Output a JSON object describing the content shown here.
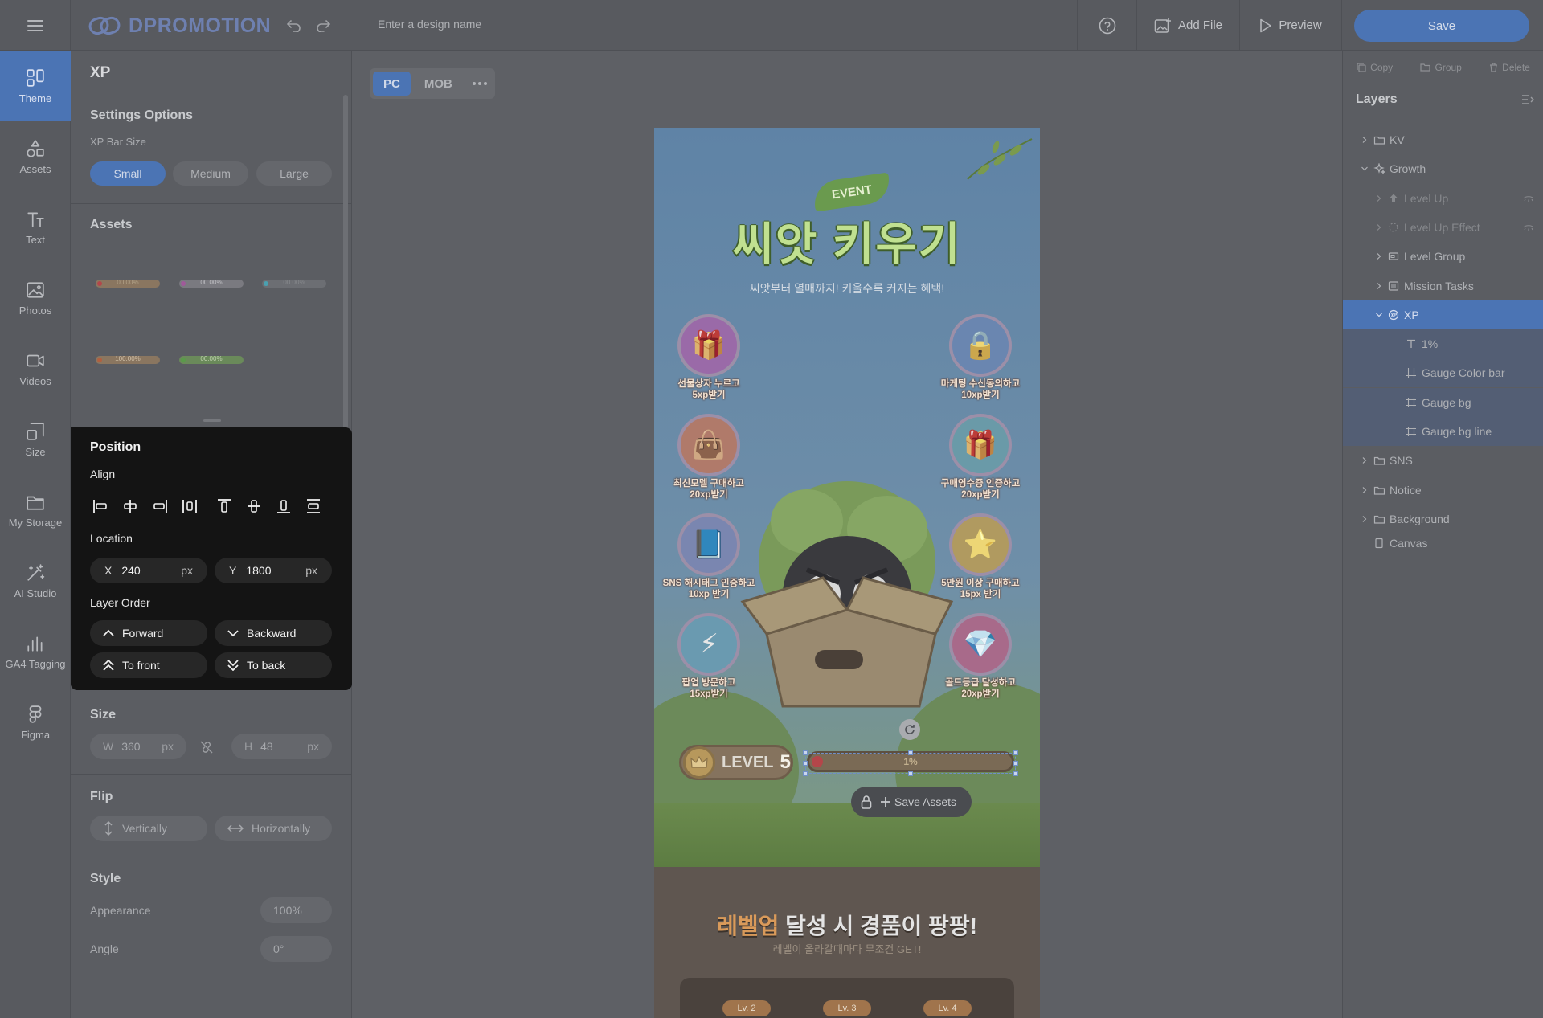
{
  "topbar": {
    "logo_text": "DPROMOTION",
    "design_name_placeholder": "Enter a design name",
    "add_file_label": "Add File",
    "preview_label": "Preview",
    "save_label": "Save"
  },
  "rail": [
    {
      "label": "Theme",
      "icon": "theme-icon",
      "active": true
    },
    {
      "label": "Assets",
      "icon": "shapes-icon"
    },
    {
      "label": "Text",
      "icon": "text-icon"
    },
    {
      "label": "Photos",
      "icon": "photo-icon"
    },
    {
      "label": "Videos",
      "icon": "video-icon"
    },
    {
      "label": "Size",
      "icon": "resize-icon"
    },
    {
      "label": "My Storage",
      "icon": "folder-icon"
    },
    {
      "label": "AI Studio",
      "icon": "magic-wand-icon"
    },
    {
      "label": "GA4 Tagging",
      "icon": "bar-chart-icon"
    },
    {
      "label": "Figma",
      "icon": "figma-icon"
    }
  ],
  "panel": {
    "title": "XP",
    "settings_title": "Settings Options",
    "xp_bar_size_label": "XP Bar Size",
    "sizes": [
      "Small",
      "Medium",
      "Large"
    ],
    "selected_size": "Small",
    "assets_title": "Assets",
    "asset_thumbs": [
      "00.00%",
      "00.00%",
      "00.00%",
      "100.00%",
      "00.00%"
    ],
    "size_title": "Size",
    "width_label": "W",
    "width_value": "360",
    "height_label": "H",
    "height_value": "48",
    "unit": "px",
    "flip_title": "Flip",
    "flip_vertical": "Vertically",
    "flip_horizontal": "Horizontally",
    "style_title": "Style",
    "appearance_label": "Appearance",
    "appearance_value": "100%",
    "angle_label": "Angle",
    "angle_value": "0°"
  },
  "position_popup": {
    "title": "Position",
    "align_label": "Align",
    "location_label": "Location",
    "x_label": "X",
    "x_value": "240",
    "y_label": "Y",
    "y_value": "1800",
    "unit": "px",
    "layer_order_label": "Layer Order",
    "forward": "Forward",
    "backward": "Backward",
    "to_front": "To front",
    "to_back": "To back"
  },
  "canvas": {
    "device_tabs": [
      "PC",
      "MOB"
    ],
    "active_device": "PC",
    "event_badge": "EVENT",
    "main_title": "씨앗 키우기",
    "subtitle": "씨앗부터 열매까지! 키울수록 커지는 혜택!",
    "missions": [
      {
        "line1": "선물상자 누르고",
        "line2": "5xp받기"
      },
      {
        "line1": "마케팅 수신동의하고",
        "line2": "10xp받기"
      },
      {
        "line1": "최신모델 구매하고",
        "line2": "20xp받기"
      },
      {
        "line1": "구매영수증 인증하고",
        "line2": "20xp받기"
      },
      {
        "line1": "SNS 해시태그 인증하고",
        "line2": "10xp 받기"
      },
      {
        "line1": "5만원 이상 구매하고",
        "line2": "15px 받기"
      },
      {
        "line1": "팝업 방문하고",
        "line2": "15xp받기"
      },
      {
        "line1": "골드등급 달성하고",
        "line2": "20xp받기"
      }
    ],
    "level_label": "LEVEL",
    "level_number": "5",
    "xp_percent_label": "1%",
    "xp_fraction": 0.01,
    "save_assets_label": "Save Assets",
    "reward_title_highlight": "레벨업",
    "reward_title_rest": " 달성 시 경품이 팡팡!",
    "reward_subtitle": "레벨이 올라갈때마다 무조건 GET!",
    "level_chips": [
      "Lv. 2",
      "Lv. 3",
      "Lv. 4"
    ]
  },
  "right_panel": {
    "actions": [
      "Copy",
      "Group",
      "Delete"
    ],
    "layers_title": "Layers",
    "layers": [
      {
        "label": "KV",
        "icon": "folder-icon",
        "depth": 0,
        "chevron": "right"
      },
      {
        "label": "Growth",
        "icon": "sparkle-icon",
        "depth": 0,
        "chevron": "down"
      },
      {
        "label": "Level Up",
        "icon": "upgrade-icon",
        "depth": 1,
        "chevron": "right",
        "hidden": true
      },
      {
        "label": "Level Up Effect",
        "icon": "effect-icon",
        "depth": 1,
        "chevron": "right",
        "hidden": true
      },
      {
        "label": "Level Group",
        "icon": "group-icon",
        "depth": 1,
        "chevron": "right"
      },
      {
        "label": "Mission Tasks",
        "icon": "list-icon",
        "depth": 1,
        "chevron": "right"
      },
      {
        "label": "XP",
        "icon": "xp-icon",
        "depth": 1,
        "chevron": "down",
        "selected": true
      },
      {
        "label": "1%",
        "icon": "text-icon",
        "depth": 2,
        "child": true
      },
      {
        "label": "Gauge Color bar",
        "icon": "frame-icon",
        "depth": 2,
        "child": true
      },
      {
        "label": "Gauge bg",
        "icon": "frame-icon",
        "depth": 2,
        "child": true
      },
      {
        "label": "Gauge bg line",
        "icon": "frame-icon",
        "depth": 2,
        "child": true
      },
      {
        "label": "SNS",
        "icon": "folder-icon",
        "depth": 0,
        "chevron": "right"
      },
      {
        "label": "Notice",
        "icon": "folder-icon",
        "depth": 0,
        "chevron": "right"
      },
      {
        "label": "Background",
        "icon": "folder-icon",
        "depth": 0,
        "chevron": "right"
      },
      {
        "label": "Canvas",
        "icon": "canvas-icon",
        "depth": 0
      }
    ]
  },
  "colors": {
    "accent": "#4b74b4",
    "popup_bg": "#141414"
  }
}
